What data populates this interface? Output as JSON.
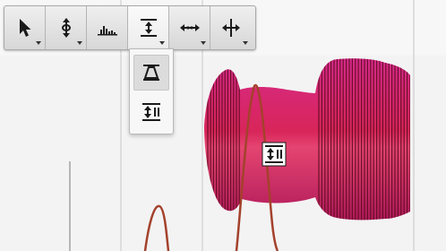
{
  "toolbar": {
    "tools": [
      {
        "id": "pointer",
        "icon": "pointer-arrow-icon",
        "has_menu": true
      },
      {
        "id": "pitch",
        "icon": "vertical-pitch-icon",
        "has_menu": true
      },
      {
        "id": "chart",
        "icon": "histogram-icon",
        "has_menu": false
      },
      {
        "id": "vertical-stretch",
        "icon": "vertical-stretch-icon",
        "has_menu": true,
        "active": true
      },
      {
        "id": "horizontal-stretch",
        "icon": "horizontal-stretch-icon",
        "has_menu": true
      },
      {
        "id": "move",
        "icon": "move-crosshair-icon",
        "has_menu": true
      }
    ]
  },
  "submenu": {
    "items": [
      {
        "icon": "taper-icon",
        "selected": true
      },
      {
        "icon": "vertical-stretch-lines-icon",
        "selected": false
      }
    ]
  },
  "colors": {
    "blob_dark": "#c8103e",
    "blob_light": "#e04a9c",
    "curve": "#a4412c",
    "background": "#f3f3f3"
  }
}
